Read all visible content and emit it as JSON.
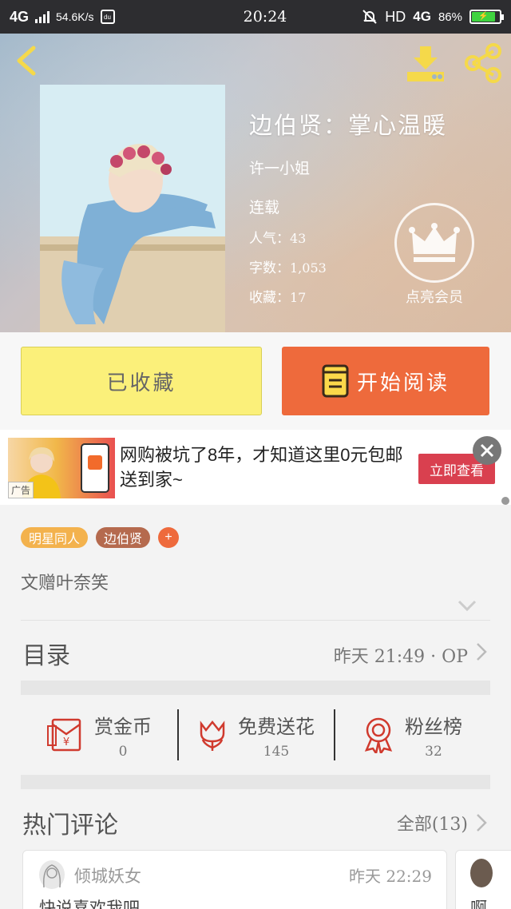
{
  "status_bar": {
    "network": "4G",
    "speed": "54.6K/s",
    "app_icon_text": "du",
    "time": "20:24",
    "hd": "HD",
    "network2": "4G",
    "battery": "86%"
  },
  "header": {
    "icons": [
      "back-icon",
      "download-icon",
      "share-icon"
    ],
    "accent": "#f5d94a"
  },
  "book": {
    "title": "边伯贤：掌心温暖",
    "author": "许一小姐",
    "status": "连载",
    "popularity_label": "人气：",
    "popularity": "43",
    "words_label": "字数：",
    "words": "1,053",
    "favorites_label": "收藏：",
    "favorites": "17",
    "vip_label": "点亮会员"
  },
  "actions": {
    "favorited_label": "已收藏",
    "read_label": "开始阅读",
    "favorited_color": "#fbf07a",
    "read_color": "#ee6a3c"
  },
  "ad": {
    "tag": "广告",
    "text": "网购被坑了8年，才知道这里0元包邮送到家~",
    "cta": "立即查看"
  },
  "tags": [
    "明星同人",
    "边伯贤",
    "+"
  ],
  "intro": "文赠叶奈笑",
  "toc": {
    "title": "目录",
    "update": "昨天 21:49 · OP"
  },
  "stats": [
    {
      "name": "赏金币",
      "value": "0",
      "icon": "red-envelope-icon"
    },
    {
      "name": "免费送花",
      "value": "145",
      "icon": "flower-icon"
    },
    {
      "name": "粉丝榜",
      "value": "32",
      "icon": "medal-icon"
    }
  ],
  "comments": {
    "title": "热门评论",
    "all": "全部(13)",
    "items": [
      {
        "user": "倾城妖女",
        "time": "昨天 22:29",
        "body": "快说喜欢我吧"
      },
      {
        "user": "",
        "time": "",
        "body": "啊"
      }
    ]
  }
}
